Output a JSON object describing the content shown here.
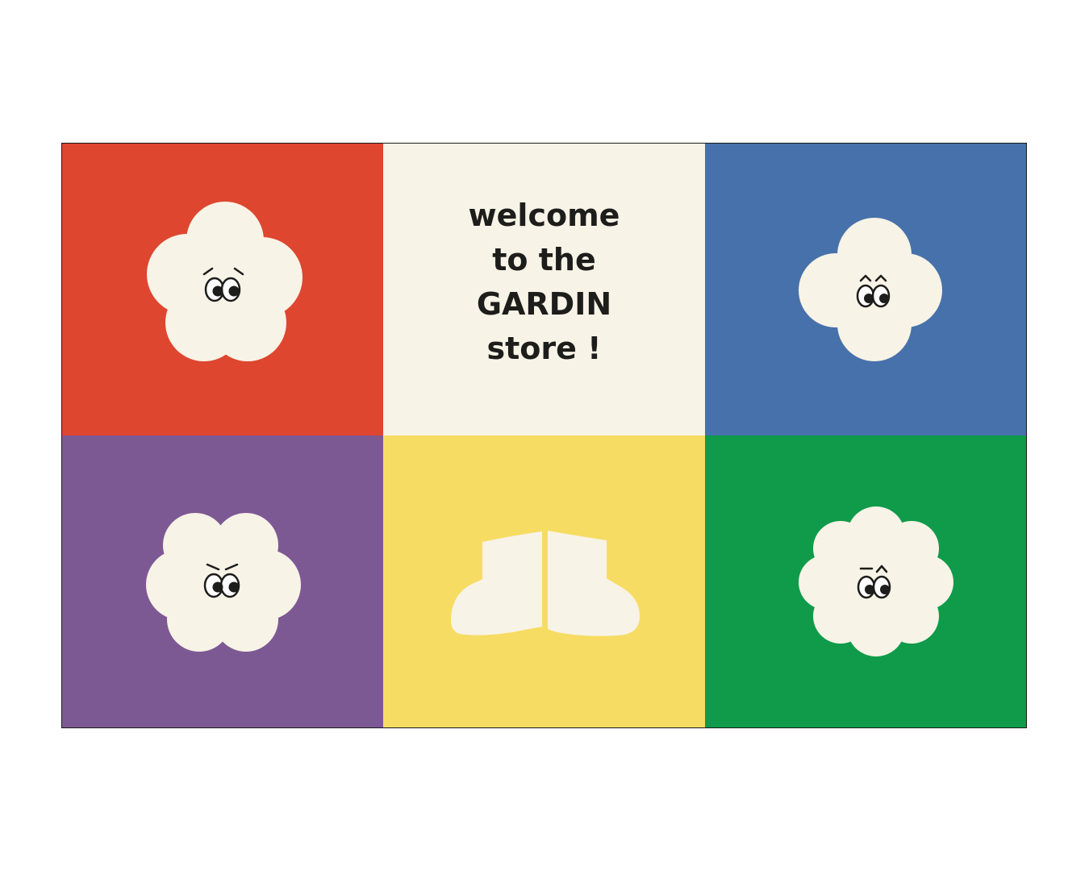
{
  "colors": {
    "red": "#de4630",
    "cream": "#f7f3e6",
    "blue": "#4771aa",
    "purple": "#7d5994",
    "yellow": "#f7dc63",
    "green": "#0f9b4a",
    "ink": "#1d1d1b"
  },
  "welcome": {
    "line1": "welcome",
    "line2": "to the",
    "line3": "GARDIN",
    "line4": "store !"
  },
  "tiles": [
    {
      "icon": "flower-icon",
      "expression": "curious"
    },
    {
      "icon": "welcome-text"
    },
    {
      "icon": "flower-icon",
      "expression": "surprised"
    },
    {
      "icon": "flower-icon",
      "expression": "angry"
    },
    {
      "icon": "boots-icon"
    },
    {
      "icon": "flower-icon",
      "expression": "skeptical"
    }
  ]
}
